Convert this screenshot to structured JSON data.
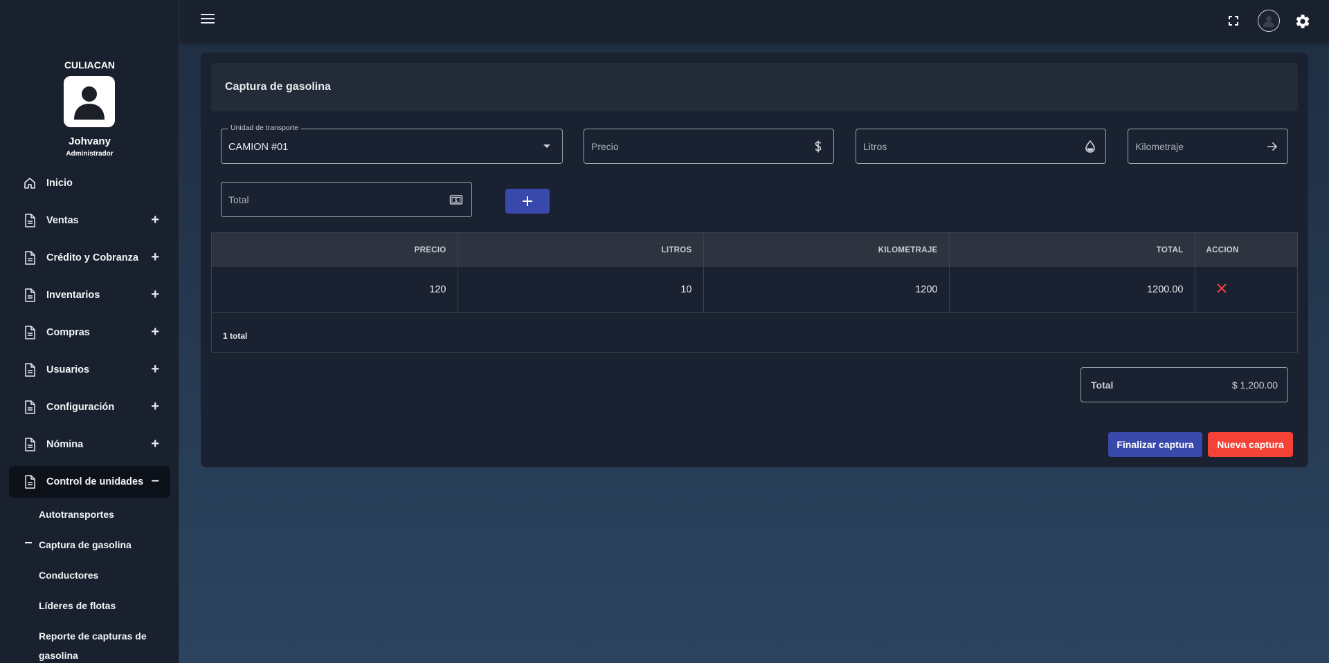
{
  "sidebar": {
    "branch": "CULIACAN",
    "user_name": "Johvany",
    "user_role": "Administrador",
    "items": [
      {
        "label": "Inicio",
        "icon": "home-icon",
        "toggle": ""
      },
      {
        "label": "Ventas",
        "icon": "document-icon",
        "toggle": "+"
      },
      {
        "label": "Crédito y Cobranza",
        "icon": "document-icon",
        "toggle": "+"
      },
      {
        "label": "Inventarios",
        "icon": "document-icon",
        "toggle": "+"
      },
      {
        "label": "Compras",
        "icon": "document-icon",
        "toggle": "+"
      },
      {
        "label": "Usuarios",
        "icon": "document-icon",
        "toggle": "+"
      },
      {
        "label": "Configuración",
        "icon": "document-icon",
        "toggle": "+"
      },
      {
        "label": "Nómina",
        "icon": "document-icon",
        "toggle": "+"
      },
      {
        "label": "Control de unidades",
        "icon": "document-icon",
        "toggle": "−"
      }
    ],
    "subitems": [
      {
        "label": "Autotransportes"
      },
      {
        "label": "Captura de gasolina"
      },
      {
        "label": "Conductores"
      },
      {
        "label": "Líderes de flotas"
      },
      {
        "label": "Reporte de capturas de"
      },
      {
        "label": "gasolina"
      }
    ]
  },
  "topbar": {
    "icons": [
      "menu-icon",
      "fullscreen-icon",
      "account-icon",
      "gear-icon"
    ]
  },
  "form": {
    "title": "Captura de gasolina",
    "unit_legend": "Unidad de transporte",
    "unit_value": "CAMION #01",
    "precio_placeholder": "Precio",
    "litros_placeholder": "Litros",
    "kilometraje_placeholder": "Kilometraje",
    "total_placeholder": "Total"
  },
  "table": {
    "headers": [
      "PRECIO",
      "LITROS",
      "KILOMETRAJE",
      "TOTAL",
      "ACCION"
    ],
    "rows": [
      {
        "precio": "120",
        "litros": "10",
        "kilometraje": "1200",
        "total": "1200.00"
      }
    ],
    "footer": "1 total"
  },
  "summary": {
    "label": "Total",
    "value": "$ 1,200.00"
  },
  "actions": {
    "finish": "Finalizar captura",
    "new": "Nueva captura"
  },
  "colors": {
    "primary": "#3949ab",
    "danger": "#f44336",
    "sidebar_bg": "#19212e",
    "card_bg": "#1a2130"
  }
}
